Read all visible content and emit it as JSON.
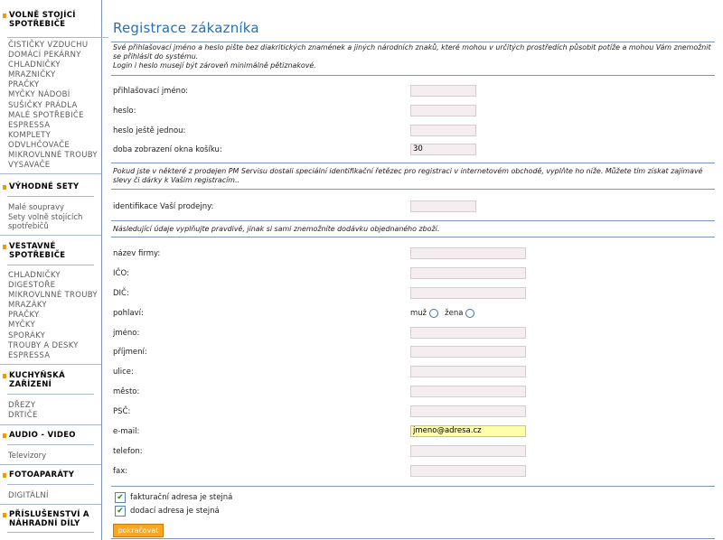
{
  "sidebar": {
    "categories": [
      {
        "title": "VOLNĚ STOJÍCÍ SPOTŘEBIČE",
        "items": [
          "ČISTIČKY VZDUCHU",
          "DOMÁCÍ PEKÁRNY",
          "CHLADNIČKY",
          "MRAZNIČKY",
          "PRAČKY",
          "MYČKY NÁDOBÍ",
          "SUŠIČKY PRÁDLA",
          "MALÉ SPOTŘEBIČE",
          "ESPRESSA",
          "KOMPLETY",
          "ODVLHČOVAČE",
          "MIKROVLNNÉ TROUBY",
          "VYSAVAČE"
        ]
      },
      {
        "title": "VÝHODNÉ SETY",
        "items": [
          "Malé soupravy",
          "Sety volně stojících spotřebičů"
        ]
      },
      {
        "title": "VESTAVNÉ SPOTŘEBIČE",
        "items": [
          "CHLADNIČKY",
          "DIGESTOŘE",
          "MIKROVLNNÉ TROUBY",
          "MRAZÁKY",
          "PRAČKY",
          "MYČKY",
          "SPORÁKY",
          "TROUBY A DESKY",
          "ESPRESSA"
        ]
      },
      {
        "title": "KUCHYŇSKÁ ZAŘÍZENÍ",
        "items": [
          "DŘEZY",
          "DRTIČE"
        ]
      },
      {
        "title": "AUDIO - VIDEO",
        "items": [
          "Televizory"
        ]
      },
      {
        "title": "FOTOAPARÁTY",
        "items": [
          "DIGITÁLNÍ"
        ]
      },
      {
        "title": "PŘÍSLUŠENSTVÍ A NÁHRADNÍ DÍLY",
        "items": []
      }
    ]
  },
  "main": {
    "title": "Registrace zákazníka",
    "intro": "Své přihlašovací jméno a heslo pište bez diakritických znamének a jiných národních znaků, které mohou v určitých prostředích působit potíže a mohou Vám znemožnit se přihlásit do systému.\nLogin i heslo musejí být zároveň minimálně pětiznakové.",
    "login_fields": [
      {
        "label": "přihlašovací jméno:",
        "value": ""
      },
      {
        "label": "heslo:",
        "value": ""
      },
      {
        "label": "heslo ještě jednou:",
        "value": ""
      },
      {
        "label": "doba zobrazení okna košíku:",
        "value": "30"
      }
    ],
    "pm_note": "Pokud jste v některé z prodejen PM Servisu dostali speciální identifikační řetězec pro registraci v internetovém obchodě, vyplňte ho níže. Můžete tím získat zajímavé slevy či dárky k Vašim registracím..",
    "pm_field": {
      "label": "identifikace Vaší prodejny:",
      "value": ""
    },
    "personal_note": "Následující údaje vyplňujte pravdivě, jinak si sami znemožníte dodávku objednaného zboží.",
    "personal_fields": [
      {
        "label": "název firmy:",
        "value": ""
      },
      {
        "label": "IČO:",
        "value": ""
      },
      {
        "label": "DIČ:",
        "value": ""
      },
      {
        "label": "jméno:",
        "value": ""
      },
      {
        "label": "příjmení:",
        "value": ""
      },
      {
        "label": "ulice:",
        "value": ""
      },
      {
        "label": "město:",
        "value": ""
      },
      {
        "label": "PSČ:",
        "value": ""
      },
      {
        "label": "e-mail:",
        "value": "jmeno@adresa.cz"
      },
      {
        "label": "telefon:",
        "value": ""
      },
      {
        "label": "fax:",
        "value": ""
      }
    ],
    "gender": {
      "label": "pohlaví:",
      "option_male": "muž",
      "option_female": "žena"
    },
    "checkboxes": [
      {
        "label": "fakturační adresa je stejná",
        "checked": true
      },
      {
        "label": "dodací adresa je stejná",
        "checked": true
      }
    ],
    "submit_label": "pokračovat"
  },
  "colors": {
    "accent": "#2a6fb0",
    "bullet": "#f29a00",
    "submit": "#f5a623",
    "input_bg": "#f4eef0",
    "highlight": "#ffffaa"
  }
}
